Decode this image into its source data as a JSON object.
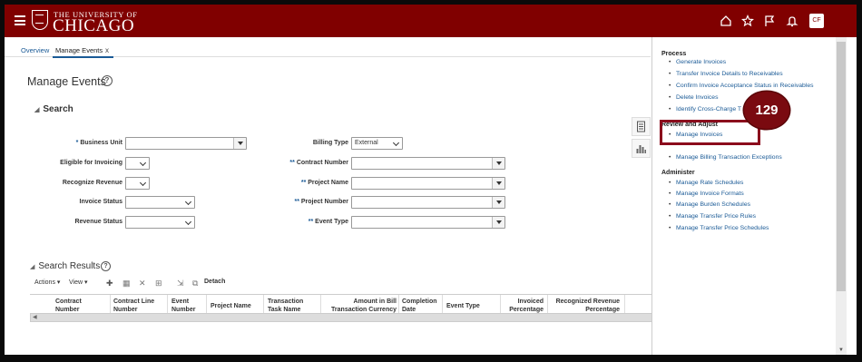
{
  "header": {
    "university_top": "THE UNIVERSITY OF",
    "university_main": "CHICAGO",
    "avatar_initials": "CF",
    "brand_color": "#800000"
  },
  "tabs": [
    {
      "label": "Overview"
    },
    {
      "label": "Manage Events"
    }
  ],
  "tab_close": "x",
  "page_title": "Manage Events",
  "help_glyph": "?",
  "search": {
    "heading": "Search",
    "fields": {
      "business_unit": {
        "label": "Business Unit",
        "req": "*"
      },
      "eligible_for_invoicing": {
        "label": "Eligible for Invoicing"
      },
      "recognize_revenue": {
        "label": "Recognize Revenue"
      },
      "invoice_status": {
        "label": "Invoice Status"
      },
      "revenue_status": {
        "label": "Revenue Status"
      },
      "billing_type": {
        "label": "Billing Type",
        "value": "External"
      },
      "contract_number": {
        "label": "Contract Number",
        "req": "**"
      },
      "project_name": {
        "label": "Project Name",
        "req": "**"
      },
      "project_number": {
        "label": "Project Number",
        "req": "**"
      },
      "event_type": {
        "label": "Event Type",
        "req": "**"
      }
    }
  },
  "results": {
    "heading": "Search Results",
    "toolbar": {
      "actions": "Actions",
      "view": "View",
      "detach": "Detach"
    },
    "columns": [
      "Contract\nNumber",
      "Contract Line\nNumber",
      "Event\nNumber",
      "Project Name",
      "Transaction\nTask Name",
      "Amount in Bill\nTransaction Currency",
      "Completion\nDate",
      "Event Type",
      "Invoiced\nPercentage",
      "Recognized Revenue\nPercentage"
    ]
  },
  "right_panel": {
    "process": {
      "heading": "Process",
      "links": [
        "Generate Invoices",
        "Transfer Invoice Details to Receivables",
        "Confirm Invoice Acceptance Status in Receivables",
        "Delete Invoices",
        "Identify Cross-Charge T"
      ]
    },
    "review": {
      "heading": "Review and Adjust",
      "links": [
        "Manage Invoices",
        "Manage Billing Transaction Exceptions"
      ]
    },
    "administer": {
      "heading": "Administer",
      "links": [
        "Manage Rate Schedules",
        "Manage Invoice Formats",
        "Manage Burden Schedules",
        "Manage Transfer Price Rules",
        "Manage Transfer Price Schedules"
      ]
    }
  },
  "callout": {
    "number": "129",
    "color": "#7a0a10"
  }
}
